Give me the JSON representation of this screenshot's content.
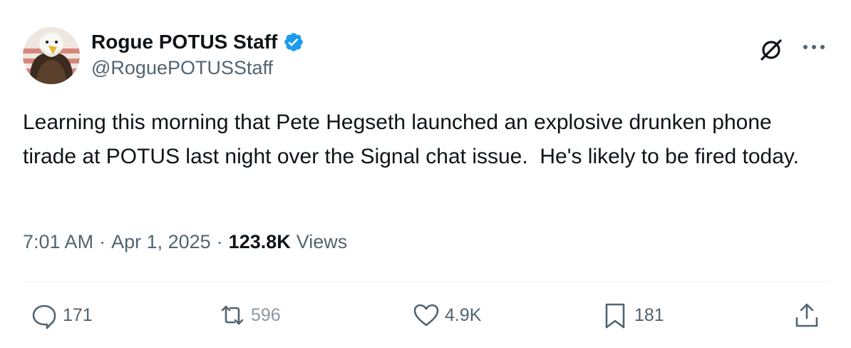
{
  "author": {
    "display_name": "Rogue POTUS Staff",
    "handle": "@RoguePOTUSStaff",
    "verified": true
  },
  "tweet": {
    "text": "Learning this morning that Pete Hegseth launched an explosive drunken phone tirade at POTUS last night over the Signal chat issue.  He's likely to be fired today.",
    "time": "7:01 AM",
    "date": "Apr 1, 2025",
    "separator": "·",
    "views_count": "123.8K",
    "views_label": "Views"
  },
  "actions": {
    "replies": "171",
    "reposts": "596",
    "likes": "4.9K",
    "bookmarks": "181"
  },
  "colors": {
    "text_primary": "#0f1419",
    "text_secondary": "#536471",
    "verified_blue": "#1d9bf0",
    "divider": "#eff3f4"
  },
  "icons": {
    "verified": "verified-badge-icon",
    "grok": "grok-icon",
    "more": "more-icon",
    "reply": "reply-icon",
    "repost": "repost-icon",
    "like": "like-icon",
    "bookmark": "bookmark-icon",
    "share": "share-icon"
  }
}
